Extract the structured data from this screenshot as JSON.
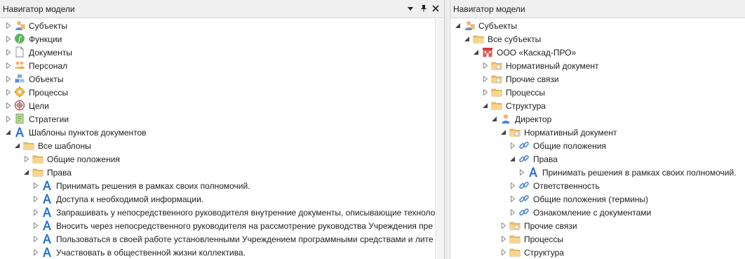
{
  "left_panel": {
    "title": "Навигатор модели",
    "controls": {
      "dropdown_icon": "dropdown-arrow-icon",
      "pin_icon": "pin-icon",
      "close_icon": "close-icon"
    },
    "rows": [
      {
        "level": 0,
        "expanded": false,
        "icon": "subjects",
        "label": "Субъекты"
      },
      {
        "level": 0,
        "expanded": false,
        "icon": "function",
        "label": "Функции"
      },
      {
        "level": 0,
        "expanded": false,
        "icon": "document",
        "label": "Документы"
      },
      {
        "level": 0,
        "expanded": false,
        "icon": "personnel",
        "label": "Персонал"
      },
      {
        "level": 0,
        "expanded": false,
        "icon": "objects",
        "label": "Объекты"
      },
      {
        "level": 0,
        "expanded": false,
        "icon": "process",
        "label": "Процессы"
      },
      {
        "level": 0,
        "expanded": false,
        "icon": "goal",
        "label": "Цели"
      },
      {
        "level": 0,
        "expanded": false,
        "icon": "strategy",
        "label": "Стратегии"
      },
      {
        "level": 0,
        "expanded": true,
        "icon": "template",
        "label": "Шаблоны пунктов документов"
      },
      {
        "level": 1,
        "expanded": true,
        "icon": "folder",
        "label": "Все шаблоны"
      },
      {
        "level": 2,
        "expanded": false,
        "icon": "folder",
        "label": "Общие положения"
      },
      {
        "level": 2,
        "expanded": true,
        "icon": "folder",
        "label": "Права"
      },
      {
        "level": 3,
        "expanded": false,
        "icon": "template",
        "label": "Принимать решения в рамках своих полномочий."
      },
      {
        "level": 3,
        "expanded": false,
        "icon": "template",
        "label": "Доступа к необходимой информации."
      },
      {
        "level": 3,
        "expanded": false,
        "icon": "template",
        "label": "Запрашивать у непосредственного руководителя внутренние документы, описывающие техноло"
      },
      {
        "level": 3,
        "expanded": false,
        "icon": "template",
        "label": "Вносить через непосредственного руководителя на рассмотрение руководства Учреждения пре"
      },
      {
        "level": 3,
        "expanded": false,
        "icon": "template",
        "label": "Пользоваться в своей работе установленными Учреждением программными средствами и лите"
      },
      {
        "level": 3,
        "expanded": false,
        "icon": "template",
        "label": "Участвовать в общественной жизни коллектива."
      }
    ]
  },
  "right_panel": {
    "title": "Навигатор модели",
    "rows": [
      {
        "level": 0,
        "expanded": true,
        "icon": "subjects",
        "label": "Субъекты"
      },
      {
        "level": 1,
        "expanded": true,
        "icon": "folder",
        "label": "Все субъекты"
      },
      {
        "level": 2,
        "expanded": true,
        "icon": "organization",
        "label": "ООО «Каскад-ПРО»"
      },
      {
        "level": 3,
        "expanded": false,
        "icon": "folder-doc",
        "label": "Нормативный документ"
      },
      {
        "level": 3,
        "expanded": false,
        "icon": "folder-doc",
        "label": "Прочие связи"
      },
      {
        "level": 3,
        "expanded": false,
        "icon": "folder",
        "label": "Процессы"
      },
      {
        "level": 3,
        "expanded": true,
        "icon": "folder",
        "label": "Структура"
      },
      {
        "level": 4,
        "expanded": true,
        "icon": "person",
        "label": "Директор"
      },
      {
        "level": 5,
        "expanded": true,
        "icon": "folder-doc",
        "label": "Нормативный документ"
      },
      {
        "level": 6,
        "expanded": false,
        "icon": "link",
        "label": "Общие положения"
      },
      {
        "level": 6,
        "expanded": true,
        "icon": "link",
        "label": "Права"
      },
      {
        "level": 7,
        "expanded": false,
        "icon": "template",
        "label": "Принимать решения в рамках своих полномочий."
      },
      {
        "level": 6,
        "expanded": false,
        "icon": "link",
        "label": "Ответственность"
      },
      {
        "level": 6,
        "expanded": false,
        "icon": "link",
        "label": "Общие положения (термины)"
      },
      {
        "level": 6,
        "expanded": false,
        "icon": "link",
        "label": "Ознакомление с документами"
      },
      {
        "level": 5,
        "expanded": false,
        "icon": "folder-doc",
        "label": "Прочие связи"
      },
      {
        "level": 5,
        "expanded": false,
        "icon": "folder",
        "label": "Процессы"
      },
      {
        "level": 5,
        "expanded": false,
        "icon": "folder",
        "label": "Структура"
      }
    ]
  },
  "colors": {
    "folder": "#f2c36b",
    "template_letter": "#1f6fd1",
    "link": "#4a84d6",
    "header_bg": "#f0f0f0"
  }
}
